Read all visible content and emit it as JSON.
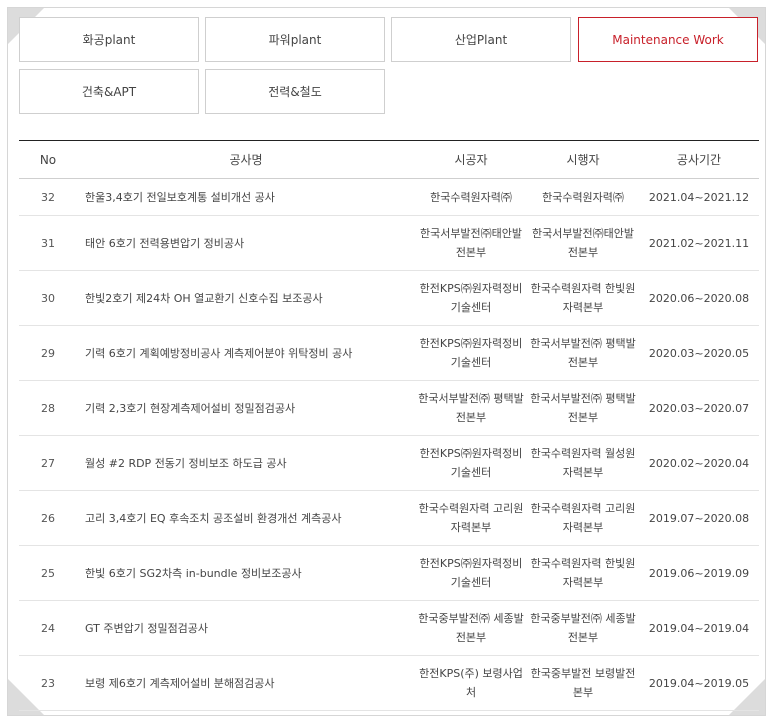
{
  "tabs": [
    {
      "label": "화공plant",
      "active": false
    },
    {
      "label": "파워plant",
      "active": false
    },
    {
      "label": "산업Plant",
      "active": false
    },
    {
      "label": "Maintenance Work",
      "active": true
    },
    {
      "label": "건축&APT",
      "active": false
    },
    {
      "label": "전력&철도",
      "active": false
    }
  ],
  "colors": {
    "accent": "#c8202a",
    "border": "#cfcfcf",
    "header_rule": "#222222"
  },
  "table": {
    "headers": [
      "No",
      "공사명",
      "시공자",
      "시행자",
      "공사기간"
    ],
    "rows": [
      {
        "no": "32",
        "title": "한울3,4호기 전일보호계통 설비개선 공사",
        "contractor": "한국수력원자력㈜",
        "client": "한국수력원자력㈜",
        "period": "2021.04~2021.12"
      },
      {
        "no": "31",
        "title": "태안 6호기 전력용변압기 정비공사",
        "contractor": "한국서부발전㈜태안발전본부",
        "client": "한국서부발전㈜태안발전본부",
        "period": "2021.02~2021.11"
      },
      {
        "no": "30",
        "title": "한빛2호기 제24차 OH 열교환기 신호수집 보조공사",
        "contractor": "한전KPS㈜원자력정비기술센터",
        "client": "한국수력원자력 한빛원자력본부",
        "period": "2020.06~2020.08"
      },
      {
        "no": "29",
        "title": "기력 6호기 계획예방정비공사 계측제어분야 위탁정비 공사",
        "contractor": "한전KPS㈜원자력정비기술센터",
        "client": "한국서부발전㈜ 평택발전본부",
        "period": "2020.03~2020.05"
      },
      {
        "no": "28",
        "title": "기력 2,3호기 현장계측제어설비 정밀점검공사",
        "contractor": "한국서부발전㈜ 평택발전본부",
        "client": "한국서부발전㈜ 평택발전본부",
        "period": "2020.03~2020.07"
      },
      {
        "no": "27",
        "title": "월성 #2 RDP 전동기 정비보조 하도급 공사",
        "contractor": "한전KPS㈜원자력정비기술센터",
        "client": "한국수력원자력 월성원자력본부",
        "period": "2020.02~2020.04"
      },
      {
        "no": "26",
        "title": "고리 3,4호기 EQ 후속조치 공조설비 환경개선 계측공사",
        "contractor": "한국수력원자력 고리원자력본부",
        "client": "한국수력원자력 고리원자력본부",
        "period": "2019.07~2020.08"
      },
      {
        "no": "25",
        "title": "한빛 6호기 SG2차측 in-bundle 정비보조공사",
        "contractor": "한전KPS㈜원자력정비기술센터",
        "client": "한국수력원자력 한빛원자력본부",
        "period": "2019.06~2019.09"
      },
      {
        "no": "24",
        "title": "GT 주변압기 정밀점검공사",
        "contractor": "한국중부발전㈜ 세종발전본부",
        "client": "한국중부발전㈜ 세종발전본부",
        "period": "2019.04~2019.04"
      },
      {
        "no": "23",
        "title": "보령 제6호기 계측제어설비 분해점검공사",
        "contractor": "한전KPS(주) 보령사업처",
        "client": "한국중부발전 보령발전본부",
        "period": "2019.04~2019.05"
      }
    ]
  }
}
